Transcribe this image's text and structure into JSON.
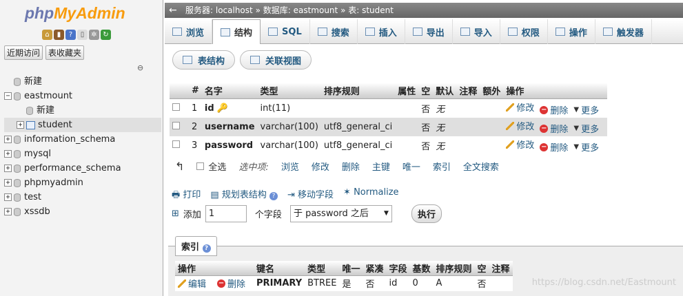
{
  "logo": {
    "part1": "php",
    "part2": "MyAdmin"
  },
  "left_tabs": [
    "近期访问",
    "表收藏夹"
  ],
  "tree": [
    {
      "label": "新建",
      "level": 0,
      "kind": "new"
    },
    {
      "label": "eastmount",
      "level": 0,
      "kind": "db",
      "expander": "−"
    },
    {
      "label": "新建",
      "level": 1,
      "kind": "new"
    },
    {
      "label": "student",
      "level": 1,
      "kind": "table",
      "expander": "+",
      "selected": true
    },
    {
      "label": "information_schema",
      "level": 0,
      "kind": "db",
      "expander": "+"
    },
    {
      "label": "mysql",
      "level": 0,
      "kind": "db",
      "expander": "+"
    },
    {
      "label": "performance_schema",
      "level": 0,
      "kind": "db",
      "expander": "+"
    },
    {
      "label": "phpmyadmin",
      "level": 0,
      "kind": "db",
      "expander": "+"
    },
    {
      "label": "test",
      "level": 0,
      "kind": "db",
      "expander": "+"
    },
    {
      "label": "xssdb",
      "level": 0,
      "kind": "db",
      "expander": "+"
    }
  ],
  "breadcrumb": {
    "server": "服务器: localhost",
    "sep": "»",
    "db": "数据库: eastmount",
    "table": "表: student"
  },
  "tabs": [
    {
      "label": "浏览",
      "icon": "browse-icon"
    },
    {
      "label": "结构",
      "icon": "structure-icon",
      "active": true
    },
    {
      "label": "SQL",
      "icon": "sql-icon"
    },
    {
      "label": "搜索",
      "icon": "search-icon"
    },
    {
      "label": "插入",
      "icon": "insert-icon"
    },
    {
      "label": "导出",
      "icon": "export-icon"
    },
    {
      "label": "导入",
      "icon": "import-icon"
    },
    {
      "label": "权限",
      "icon": "privileges-icon"
    },
    {
      "label": "操作",
      "icon": "operations-icon"
    },
    {
      "label": "触发器",
      "icon": "triggers-icon"
    }
  ],
  "subtabs": {
    "structure": "表结构",
    "relation": "关联视图"
  },
  "columns_header": [
    "#",
    "名字",
    "类型",
    "排序规则",
    "属性",
    "空",
    "默认",
    "注释",
    "额外",
    "操作"
  ],
  "rows": [
    {
      "num": "1",
      "name": "id",
      "type": "int(11)",
      "collation": "",
      "null": "否",
      "default": "无"
    },
    {
      "num": "2",
      "name": "username",
      "type": "varchar(100)",
      "collation": "utf8_general_ci",
      "null": "否",
      "default": "无"
    },
    {
      "num": "3",
      "name": "password",
      "type": "varchar(100)",
      "collation": "utf8_general_ci",
      "null": "否",
      "default": "无"
    }
  ],
  "row_actions": {
    "edit": "修改",
    "delete": "删除",
    "more": "更多"
  },
  "selection": {
    "check_all": "全选",
    "label": "选中项:",
    "browse": "浏览",
    "edit": "修改",
    "delete": "删除",
    "primary": "主键",
    "unique": "唯一",
    "index": "索引",
    "fulltext": "全文搜索"
  },
  "actions": {
    "print": "打印",
    "plan": "规划表结构",
    "move": "移动字段",
    "normalize": "Normalize"
  },
  "add": {
    "label": "添加",
    "count": "1",
    "unit": "个字段",
    "position": "于 password 之后",
    "execute": "执行"
  },
  "index": {
    "legend": "索引",
    "header": [
      "操作",
      "",
      "键名",
      "类型",
      "唯一",
      "紧凑",
      "字段",
      "基数",
      "排序规则",
      "空",
      "注释"
    ],
    "row": {
      "edit": "编辑",
      "delete": "删除",
      "key": "PRIMARY",
      "type": "BTREE",
      "unique": "是",
      "packed": "否",
      "field": "id",
      "cardinality": "0",
      "collation": "A",
      "null": "否",
      "comment": ""
    }
  },
  "watermark": "https://blog.csdn.net/Eastmount",
  "colors": {
    "link": "#235a81",
    "accent": "#f89c0e",
    "logo": "#6c78af"
  }
}
